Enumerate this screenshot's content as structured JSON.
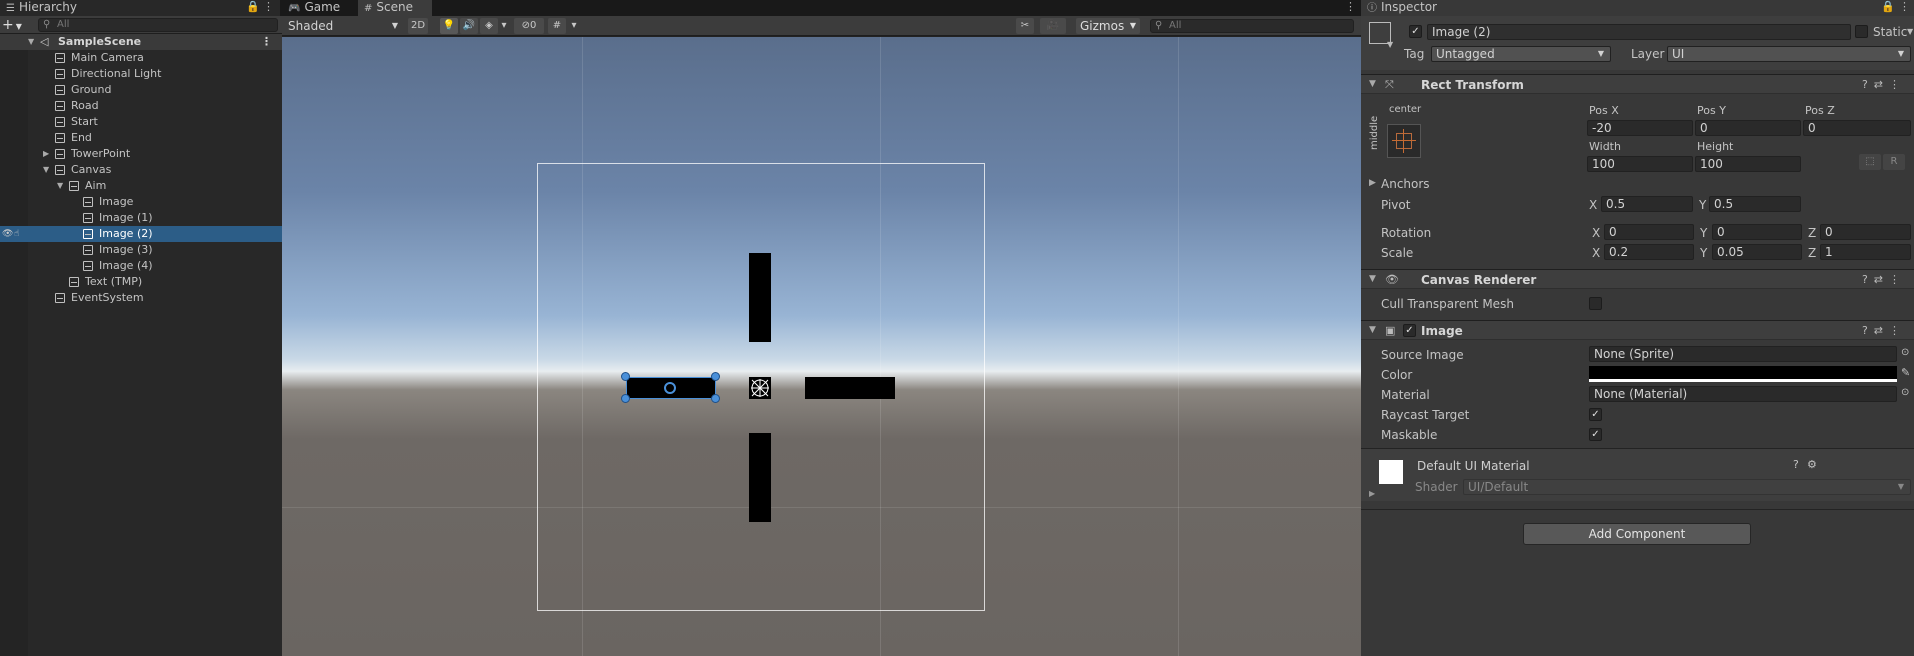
{
  "hierarchy": {
    "tab": "Hierarchy",
    "add_label": "+",
    "search_placeholder": "All",
    "scene_name": "SampleScene",
    "items": [
      {
        "label": "Main Camera"
      },
      {
        "label": "Directional Light"
      },
      {
        "label": "Ground"
      },
      {
        "label": "Road"
      },
      {
        "label": "Start"
      },
      {
        "label": "End"
      },
      {
        "label": "TowerPoint"
      },
      {
        "label": "Canvas"
      },
      {
        "label": "Aim"
      },
      {
        "label": "Image"
      },
      {
        "label": "Image (1)"
      },
      {
        "label": "Image (2)"
      },
      {
        "label": "Image (3)"
      },
      {
        "label": "Image (4)"
      },
      {
        "label": "Text (TMP)"
      },
      {
        "label": "EventSystem"
      }
    ],
    "selected": "Image (2)"
  },
  "scene_view": {
    "tabs": [
      {
        "label": "Game"
      },
      {
        "label": "Scene"
      }
    ],
    "active_tab": "Scene",
    "shading_mode": "Shaded",
    "mode_2d": "2D",
    "hidden_count": "0",
    "gizmos_label": "Gizmos",
    "search_placeholder": "All"
  },
  "inspector": {
    "tab": "Inspector",
    "object_name": "Image (2)",
    "static_label": "Static",
    "tag_label": "Tag",
    "tag_value": "Untagged",
    "layer_label": "Layer",
    "layer_value": "UI",
    "rect_transform": {
      "title": "Rect Transform",
      "anchor_h": "center",
      "anchor_v": "middle",
      "pos_x_label": "Pos X",
      "pos_x": "-20",
      "pos_y_label": "Pos Y",
      "pos_y": "0",
      "pos_z_label": "Pos Z",
      "pos_z": "0",
      "width_label": "Width",
      "width": "100",
      "height_label": "Height",
      "height": "100",
      "r_button": "R",
      "anchors_label": "Anchors",
      "pivot_label": "Pivot",
      "pivot_x": "0.5",
      "pivot_y": "0.5",
      "rotation_label": "Rotation",
      "rot_x": "0",
      "rot_y": "0",
      "rot_z": "0",
      "scale_label": "Scale",
      "scale_x": "0.2",
      "scale_y": "0.05",
      "scale_z": "1",
      "x": "X",
      "y": "Y",
      "z": "Z"
    },
    "canvas_renderer": {
      "title": "Canvas Renderer",
      "cull_label": "Cull Transparent Mesh"
    },
    "image": {
      "title": "Image",
      "source_image_label": "Source Image",
      "source_image": "None (Sprite)",
      "color_label": "Color",
      "color_value": "#000000",
      "material_label": "Material",
      "material": "None (Material)",
      "raycast_label": "Raycast Target",
      "maskable_label": "Maskable"
    },
    "material_preview": {
      "name": "Default UI Material",
      "shader_label": "Shader",
      "shader_value": "UI/Default"
    },
    "add_component": "Add Component"
  },
  "colors": {
    "selection": "#2c5d87",
    "handle": "#4a90d9",
    "panel": "#383838"
  }
}
